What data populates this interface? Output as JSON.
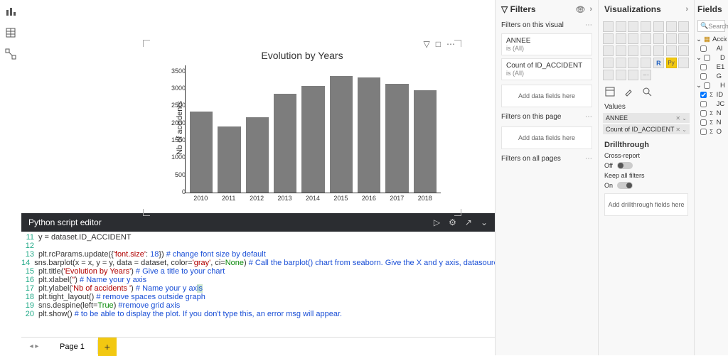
{
  "chart_data": {
    "type": "bar",
    "title": "Evolution by Years",
    "xlabel": "",
    "ylabel": "Nb of accidents",
    "ylim": [
      0,
      3700
    ],
    "y_ticks": [
      0,
      500,
      1000,
      1500,
      2000,
      2500,
      3000,
      3500
    ],
    "categories": [
      "2010",
      "2011",
      "2012",
      "2013",
      "2014",
      "2015",
      "2016",
      "2017",
      "2018"
    ],
    "values": [
      2350,
      1930,
      2200,
      2880,
      3100,
      3400,
      3350,
      3160,
      2980
    ]
  },
  "editor": {
    "title": "Python script editor",
    "lines": [
      {
        "n": "11",
        "raw": "y = dataset.ID_ACCIDENT"
      },
      {
        "n": "12",
        "raw": ""
      },
      {
        "n": "13",
        "raw": "plt.rcParams.update({'font.size': 18}) # change font size by default"
      },
      {
        "n": "14",
        "raw": "sns.barplot(x = x, y = y, data = dataset, color='gray', ci=None) # Call the barplot() chart from seaborn. Give the X and y axis, datasource and color of the bars"
      },
      {
        "n": "15",
        "raw": "plt.title('Evolution by Years') # Give a title to your chart"
      },
      {
        "n": "16",
        "raw": "plt.xlabel('') # Name your y axis"
      },
      {
        "n": "17",
        "raw": "plt.ylabel('Nb of accidents ') # Name your y axis"
      },
      {
        "n": "18",
        "raw": "plt.tight_layout() # remove spaces outside graph"
      },
      {
        "n": "19",
        "raw": "sns.despine(left=True) #remove grid axis"
      },
      {
        "n": "20",
        "raw": "plt.show() # to be able to display the plot. If you don't type this, an error msg will appear."
      }
    ]
  },
  "footer": {
    "page_tab": "Page 1"
  },
  "filters": {
    "title": "Filters",
    "on_visual": "Filters on this visual",
    "card1_name": "ANNEE",
    "card1_sub": "is (All)",
    "card2_name": "Count of ID_ACCIDENT",
    "card2_sub": "is (All)",
    "add_here": "Add data fields here",
    "on_page": "Filters on this page",
    "on_all": "Filters on all pages"
  },
  "viz": {
    "title": "Visualizations",
    "values_label": "Values",
    "field1": "ANNEE",
    "field2": "Count of ID_ACCIDENT",
    "drill_title": "Drillthrough",
    "cross_report": "Cross-report",
    "off": "Off",
    "keep_filters": "Keep all filters",
    "on": "On",
    "add_drill": "Add drillthrough fields here"
  },
  "fields": {
    "title": "Fields",
    "search": "Search",
    "table": "Accid",
    "rows": [
      {
        "sig": "",
        "label": "Al",
        "checked": false
      },
      {
        "sig": "",
        "label": "D",
        "checked": false,
        "caret": true
      },
      {
        "sig": "",
        "label": "E1",
        "checked": false
      },
      {
        "sig": "",
        "label": "G",
        "checked": false
      },
      {
        "sig": "",
        "label": "H",
        "checked": false,
        "caret": true
      },
      {
        "sig": "Σ",
        "label": "ID",
        "checked": true
      },
      {
        "sig": "",
        "label": "JC",
        "checked": false
      },
      {
        "sig": "Σ",
        "label": "N",
        "checked": false
      },
      {
        "sig": "Σ",
        "label": "N",
        "checked": false
      },
      {
        "sig": "Σ",
        "label": "O",
        "checked": false
      }
    ]
  }
}
